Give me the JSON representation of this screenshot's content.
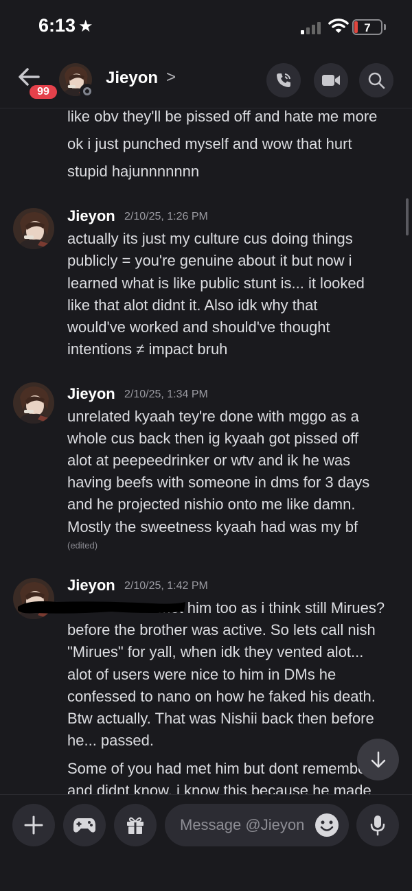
{
  "status": {
    "time": "6:13",
    "battery": "7"
  },
  "header": {
    "badge": "99",
    "name": "Jieyon",
    "chevron": ">"
  },
  "messages": {
    "prev_lines": [
      "like obv they'll be pissed off and hate me more",
      "ok i just punched myself and wow that hurt",
      "stupid hajunnnnnnn"
    ],
    "groups": [
      {
        "author": "Jieyon",
        "time": "2/10/25, 1:26 PM",
        "lines": [
          "actually its just my culture cus doing things",
          "publicly = you're genuine about it but now i",
          "learned what is like public stunt is... it looked",
          "like that alot didnt it. Also idk why that",
          "would've worked and should've thought",
          "intentions ≠ impact bruh"
        ]
      },
      {
        "author": "Jieyon",
        "time": "2/10/25, 1:34 PM",
        "lines": [
          "unrelated kyaah tey're done with mggo as a",
          "whole cus back then ig kyaah got pissed off",
          "alot at peepeedrinker or wtv and ik he was",
          "having beefs with someone in dms for 3 days",
          "and he projected nishio onto me like damn.",
          "Mostly the sweetness kyaah had was my bf"
        ],
        "edited": "(edited)"
      },
      {
        "author": "Jieyon",
        "time": "2/10/25, 1:42 PM",
        "lines": [
          "met him too as i think still Mirues?",
          "before the brother was active. So lets call nish",
          "\"Mirues\" for yall, when idk they vented alot...",
          "alot of users were nice to him in DMs he",
          "confessed to nano on how he faked his death.",
          "Btw actually. That was Nishii back then before",
          "he... passed."
        ],
        "followup": [
          "Some of you had met him but dont remember",
          "and didnt know. i know this because he made"
        ]
      }
    ]
  },
  "composer": {
    "placeholder": "Message @Jieyon"
  },
  "icons": {
    "back": "arrow-left-icon",
    "call": "phone-call-icon",
    "video": "video-camera-icon",
    "search": "search-icon",
    "jump": "arrow-down-icon",
    "add": "plus-icon",
    "games": "gamepad-icon",
    "gift": "gift-icon",
    "emoji": "emoji-smile-icon",
    "mic": "microphone-icon"
  },
  "colors": {
    "background": "#1a1a1e",
    "badge": "#e4414b",
    "button": "#2c2c33",
    "battery": "#e0463e"
  }
}
